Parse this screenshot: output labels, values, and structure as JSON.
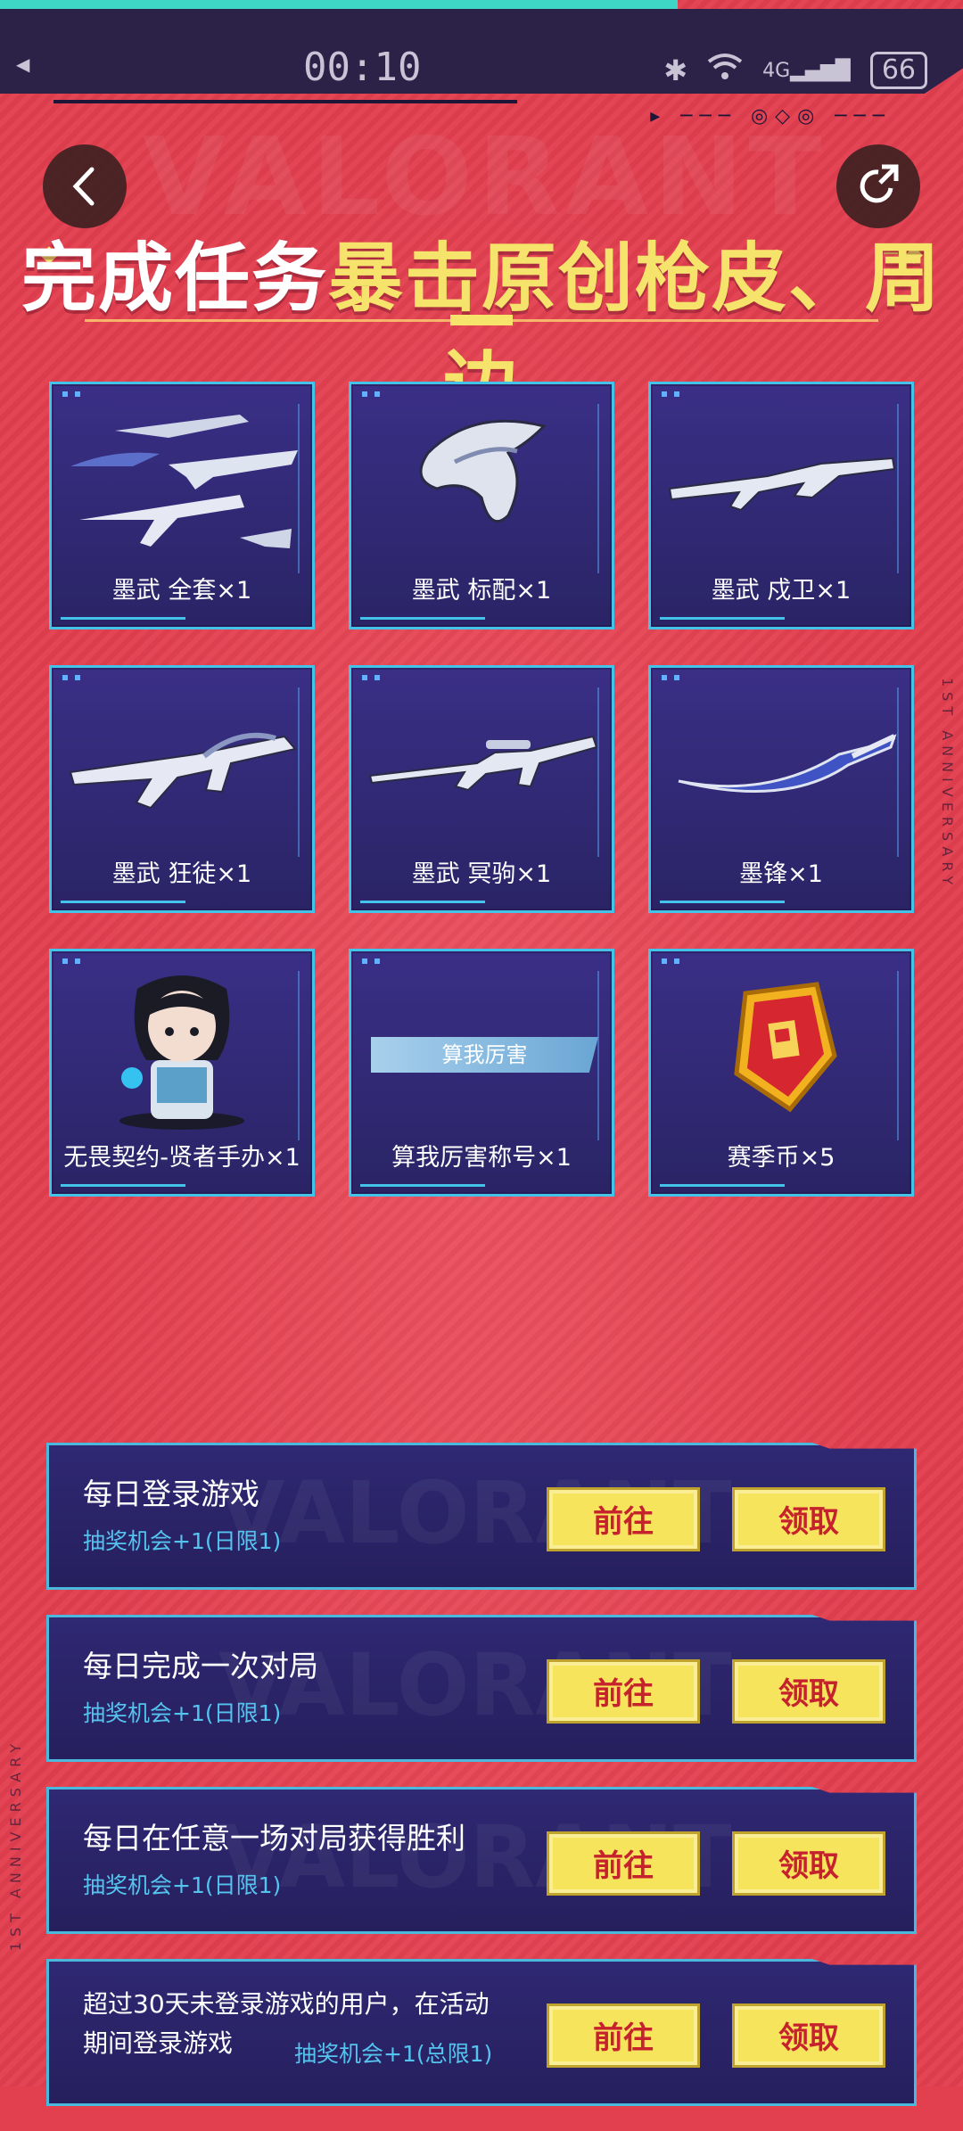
{
  "status": {
    "time": "00:10",
    "network": "4G",
    "battery": "66"
  },
  "header": {
    "headline_white": "完成任务",
    "headline_yellow": "暴击原创枪皮、周边",
    "background_text": "VALORANT",
    "side_text": "1ST ANNIVERSARY"
  },
  "rewards": [
    {
      "label": "墨武 全套×1",
      "icon": "weapon-set-icon"
    },
    {
      "label": "墨武 标配×1",
      "icon": "melee-skin-icon"
    },
    {
      "label": "墨武 戍卫×1",
      "icon": "rifle-skin-icon"
    },
    {
      "label": "墨武 狂徒×1",
      "icon": "vandal-skin-icon"
    },
    {
      "label": "墨武 冥驹×1",
      "icon": "sniper-skin-icon"
    },
    {
      "label": "墨锋×1",
      "icon": "blade-skin-icon"
    },
    {
      "label": "无畏契约-贤者手办×1",
      "icon": "figure-icon"
    },
    {
      "label": "算我厉害称号×1",
      "icon": "title-tag-icon",
      "tag": "算我厉害"
    },
    {
      "label": "赛季币×5",
      "icon": "season-coin-icon"
    }
  ],
  "tasks": [
    {
      "title": "每日登录游戏",
      "sub": "抽奖机会+1(日限1)",
      "go": "前往",
      "claim": "领取"
    },
    {
      "title": "每日完成一次对局",
      "sub": "抽奖机会+1(日限1)",
      "go": "前往",
      "claim": "领取"
    },
    {
      "title": "每日在任意一场对局获得胜利",
      "sub": "抽奖机会+1(日限1)",
      "go": "前往",
      "claim": "领取"
    },
    {
      "title": "超过30天未登录游戏的用户，在活动期间登录游戏",
      "sub": "抽奖机会+1(总限1)",
      "go": "前往",
      "claim": "领取"
    }
  ],
  "colors": {
    "background": "#e23f4f",
    "card_bg": "#2f2873",
    "card_border": "#43c3e9",
    "highlight": "#f5e36b",
    "button_bg": "#f6e45c",
    "button_text": "#c6222d",
    "sub_text": "#54c4ef"
  }
}
